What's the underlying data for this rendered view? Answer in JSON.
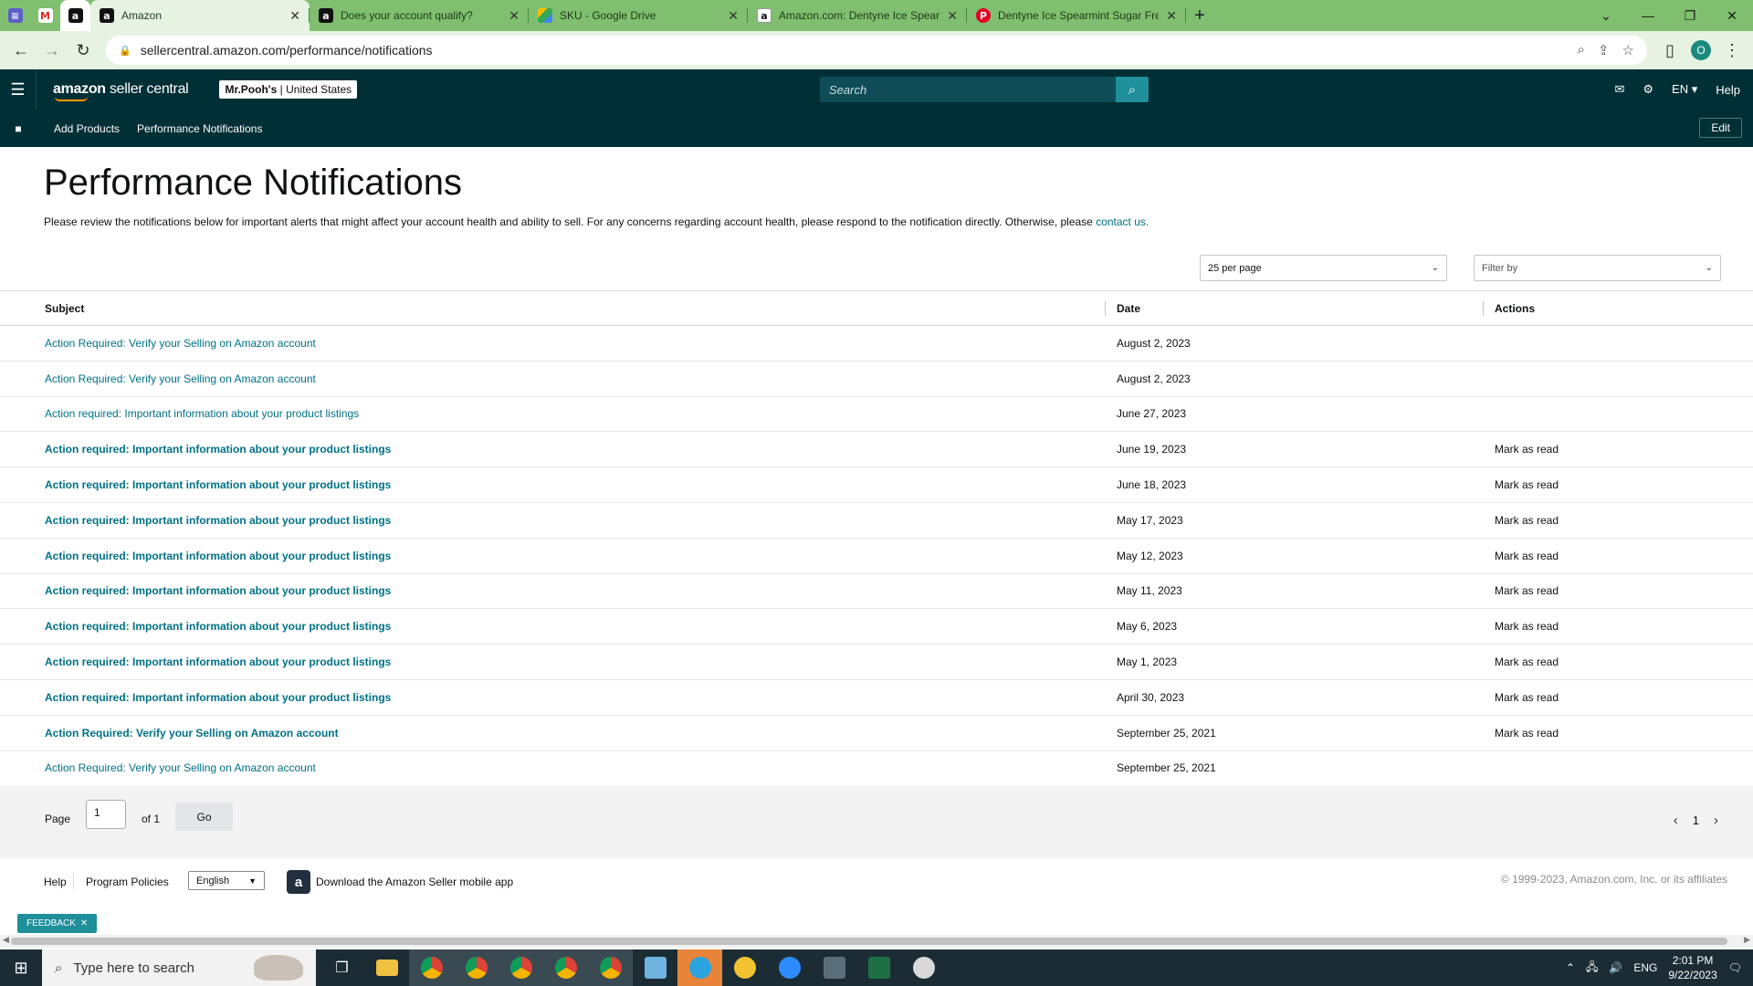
{
  "browser": {
    "tabs": [
      {
        "title": "Amazon",
        "active": true
      },
      {
        "title": "Does your account qualify?",
        "active": false
      },
      {
        "title": "SKU - Google Drive",
        "active": false
      },
      {
        "title": "Amazon.com: Dentyne Ice Spear",
        "active": false
      },
      {
        "title": "Dentyne Ice Spearmint Sugar Fre",
        "active": false
      }
    ],
    "url": "sellercentral.amazon.com/performance/notifications",
    "profile_initial": "O"
  },
  "header": {
    "logo_bold": "amazon",
    "logo_light": "seller central",
    "store_name": "Mr.Pooh's",
    "store_region": "United States",
    "search_placeholder": "Search",
    "lang": "EN",
    "help": "Help"
  },
  "nav": {
    "links": [
      "Add Products",
      "Performance Notifications"
    ],
    "edit_label": "Edit"
  },
  "page": {
    "title": "Performance Notifications",
    "description": "Please review the notifications below for important alerts that might affect your account health and ability to sell. For any concerns regarding account health, please respond to the notification directly. Otherwise, please",
    "contact_link": "contact us.",
    "per_page": "25 per page",
    "filter_placeholder": "Filter by"
  },
  "table": {
    "columns": [
      "Subject",
      "Date",
      "Actions"
    ],
    "rows": [
      {
        "subject": "Action Required: Verify your Selling on Amazon account",
        "date": "August 2, 2023",
        "action": "",
        "unread": false
      },
      {
        "subject": "Action Required: Verify your Selling on Amazon account",
        "date": "August 2, 2023",
        "action": "",
        "unread": false
      },
      {
        "subject": "Action required: Important information about your product listings",
        "date": "June 27, 2023",
        "action": "",
        "unread": false
      },
      {
        "subject": "Action required: Important information about your product listings",
        "date": "June 19, 2023",
        "action": "Mark as read",
        "unread": true
      },
      {
        "subject": "Action required: Important information about your product listings",
        "date": "June 18, 2023",
        "action": "Mark as read",
        "unread": true
      },
      {
        "subject": "Action required: Important information about your product listings",
        "date": "May 17, 2023",
        "action": "Mark as read",
        "unread": true
      },
      {
        "subject": "Action required: Important information about your product listings",
        "date": "May 12, 2023",
        "action": "Mark as read",
        "unread": true
      },
      {
        "subject": "Action required: Important information about your product listings",
        "date": "May 11, 2023",
        "action": "Mark as read",
        "unread": true
      },
      {
        "subject": "Action required: Important information about your product listings",
        "date": "May 6, 2023",
        "action": "Mark as read",
        "unread": true
      },
      {
        "subject": "Action required: Important information about your product listings",
        "date": "May 1, 2023",
        "action": "Mark as read",
        "unread": true
      },
      {
        "subject": "Action required: Important information about your product listings",
        "date": "April 30, 2023",
        "action": "Mark as read",
        "unread": true
      },
      {
        "subject": "Action Required: Verify your Selling on Amazon account",
        "date": "September 25, 2021",
        "action": "Mark as read",
        "unread": true
      },
      {
        "subject": "Action Required: Verify your Selling on Amazon account",
        "date": "September 25, 2021",
        "action": "",
        "unread": false
      }
    ]
  },
  "pager": {
    "page_label": "Page",
    "page_value": "1",
    "of_label": "of 1",
    "go_label": "Go",
    "current": "1"
  },
  "footer": {
    "help": "Help",
    "policies": "Program Policies",
    "language": "English",
    "app_text": "Download the Amazon Seller mobile app",
    "copyright": "© 1999-2023, Amazon.com, Inc. or its affiliates",
    "feedback": "FEEDBACK"
  },
  "taskbar": {
    "search_placeholder": "Type here to search",
    "lang": "ENG",
    "time": "2:01 PM",
    "date": "9/22/2023"
  },
  "colors": {
    "header_bg": "#002f36",
    "link": "#007185",
    "tab_strip": "#7fbf6f"
  }
}
